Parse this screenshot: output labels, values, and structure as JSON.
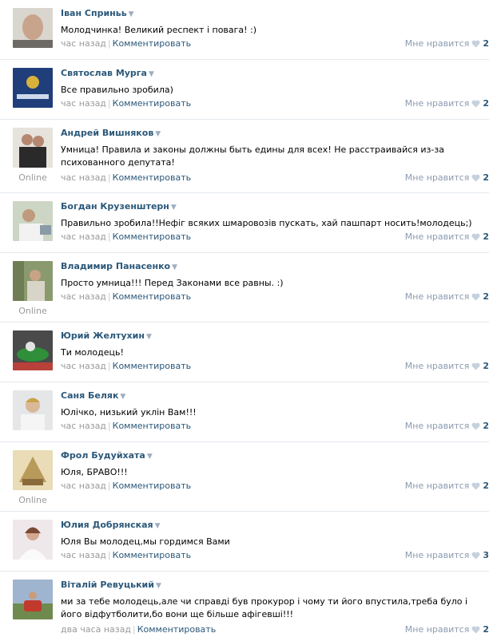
{
  "comments": [
    {
      "name": "Іван Сприньь",
      "text": "Молодчинка! Великий респект і повага! :)",
      "time": "час назад",
      "action": "Комментировать",
      "like": "Мне нравится",
      "count": "2",
      "online": ""
    },
    {
      "name": "Святослав Мурга",
      "text": "Все правильно зробила)",
      "time": "час назад",
      "action": "Комментировать",
      "like": "Мне нравится",
      "count": "2",
      "online": ""
    },
    {
      "name": "Андрей Вишняков",
      "text": "Умница! Правила и законы должны быть едины для всех! Не расстраивайся из-за психованного депутата!",
      "time": "час назад",
      "action": "Комментировать",
      "like": "Мне нравится",
      "count": "2",
      "online": "Online"
    },
    {
      "name": "Богдан Крузенштерн",
      "text": "Правильно зробила!!Нефіг всяких шмаровозів пускать, хай пашпарт носить!молодець;)",
      "time": "час назад",
      "action": "Комментировать",
      "like": "Мне нравится",
      "count": "2",
      "online": ""
    },
    {
      "name": "Владимир Панасенко",
      "text": "Просто умница!!! Перед Законами все равны. :)",
      "time": "час назад",
      "action": "Комментировать",
      "like": "Мне нравится",
      "count": "2",
      "online": "Online"
    },
    {
      "name": "Юрий Желтухин",
      "text": "Ти молодець!",
      "time": "час назад",
      "action": "Комментировать",
      "like": "Мне нравится",
      "count": "2",
      "online": ""
    },
    {
      "name": "Саня Беляк",
      "text": "Юлічко, низький уклін Вам!!!",
      "time": "час назад",
      "action": "Комментировать",
      "like": "Мне нравится",
      "count": "2",
      "online": ""
    },
    {
      "name": "Фрол Будуйхата",
      "text": "Юля, БРАВО!!!",
      "time": "час назад",
      "action": "Комментировать",
      "like": "Мне нравится",
      "count": "2",
      "online": "Online"
    },
    {
      "name": "Юлия Добрянская",
      "text": "Юля Вы молодец,мы гордимся Вами",
      "time": "час назад",
      "action": "Комментировать",
      "like": "Мне нравится",
      "count": "3",
      "online": ""
    },
    {
      "name": "Віталій Ревуцький",
      "text": "ми за тебе молодець,але чи справді був прокурор і чому ти його впустила,треба було і його відфутболити,бо вони ще більше афігевші!!!",
      "time": "два часа назад",
      "action": "Комментировать",
      "like": "Мне нравится",
      "count": "2",
      "online": ""
    }
  ],
  "colors": {
    "link": "#2b587a",
    "muted": "#999999",
    "heart": "#c6d1dd"
  }
}
